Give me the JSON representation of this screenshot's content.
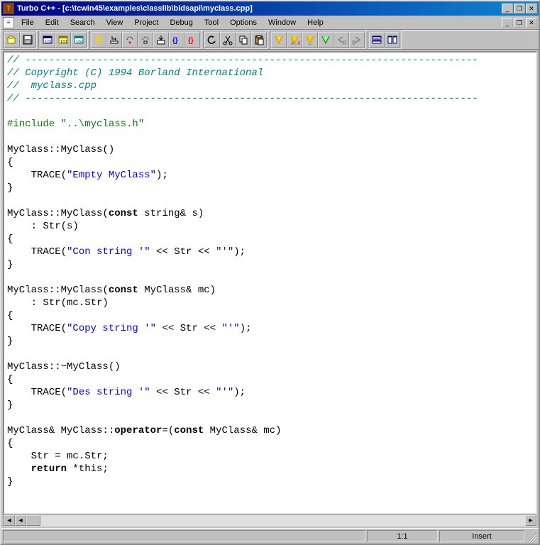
{
  "window": {
    "title": "Turbo C++ - [c:\\tcwin45\\examples\\classlib\\bidsapi\\myclass.cpp]"
  },
  "menu": {
    "items": [
      "File",
      "Edit",
      "Search",
      "View",
      "Project",
      "Debug",
      "Tool",
      "Options",
      "Window",
      "Help"
    ]
  },
  "toolbar": {
    "buttons": [
      "open",
      "save",
      "view-proj",
      "view-msg",
      "view-tree",
      "run",
      "step",
      "trace",
      "eval",
      "watch",
      "break-set",
      "break-list",
      "undo",
      "cut",
      "copy",
      "paste",
      "find",
      "find-next",
      "replace",
      "goto",
      "prev-err",
      "next-err",
      "tile-h",
      "tile-v"
    ]
  },
  "status": {
    "position": "1:1",
    "mode": "Insert"
  },
  "code": {
    "lines": [
      {
        "t": "cm",
        "s": "// ----------------------------------------------------------------------------"
      },
      {
        "t": "cm",
        "s": "// Copyright (C) 1994 Borland International"
      },
      {
        "t": "cm",
        "s": "//  myclass.cpp"
      },
      {
        "t": "cm",
        "s": "// ----------------------------------------------------------------------------"
      },
      {
        "t": "bl",
        "s": ""
      },
      {
        "t": "pp",
        "s": "#include \"..\\myclass.h\""
      },
      {
        "t": "bl",
        "s": ""
      },
      {
        "t": "pl",
        "s": "MyClass::MyClass()"
      },
      {
        "t": "pl",
        "s": "{"
      },
      {
        "t": "tr",
        "p": "    TRACE(",
        "q": "\"Empty MyClass\"",
        "r": ");"
      },
      {
        "t": "pl",
        "s": "}"
      },
      {
        "t": "bl",
        "s": ""
      },
      {
        "t": "fn",
        "p": "MyClass::MyClass(",
        "k": "const",
        "a": " string& s)"
      },
      {
        "t": "pl",
        "s": "    : Str(s)"
      },
      {
        "t": "pl",
        "s": "{"
      },
      {
        "t": "tr",
        "p": "    TRACE(",
        "q": "\"Con string '\"",
        "m": " << Str << ",
        "q2": "\"'\"",
        "r": ");"
      },
      {
        "t": "pl",
        "s": "}"
      },
      {
        "t": "bl",
        "s": ""
      },
      {
        "t": "fn",
        "p": "MyClass::MyClass(",
        "k": "const",
        "a": " MyClass& mc)"
      },
      {
        "t": "pl",
        "s": "    : Str(mc.Str)"
      },
      {
        "t": "pl",
        "s": "{"
      },
      {
        "t": "tr",
        "p": "    TRACE(",
        "q": "\"Copy string '\"",
        "m": " << Str << ",
        "q2": "\"'\"",
        "r": ");"
      },
      {
        "t": "pl",
        "s": "}"
      },
      {
        "t": "bl",
        "s": ""
      },
      {
        "t": "pl",
        "s": "MyClass::~MyClass()"
      },
      {
        "t": "pl",
        "s": "{"
      },
      {
        "t": "tr",
        "p": "    TRACE(",
        "q": "\"Des string '\"",
        "m": " << Str << ",
        "q2": "\"'\"",
        "r": ");"
      },
      {
        "t": "pl",
        "s": "}"
      },
      {
        "t": "bl",
        "s": ""
      },
      {
        "t": "op",
        "p": "MyClass& MyClass::",
        "k": "operator",
        "e": "=(",
        "k2": "const",
        "a": " MyClass& mc)"
      },
      {
        "t": "pl",
        "s": "{"
      },
      {
        "t": "pl",
        "s": "    Str = mc.Str;"
      },
      {
        "t": "rt",
        "p": "    ",
        "k": "return",
        "a": " *this;"
      },
      {
        "t": "pl",
        "s": "}"
      }
    ]
  }
}
